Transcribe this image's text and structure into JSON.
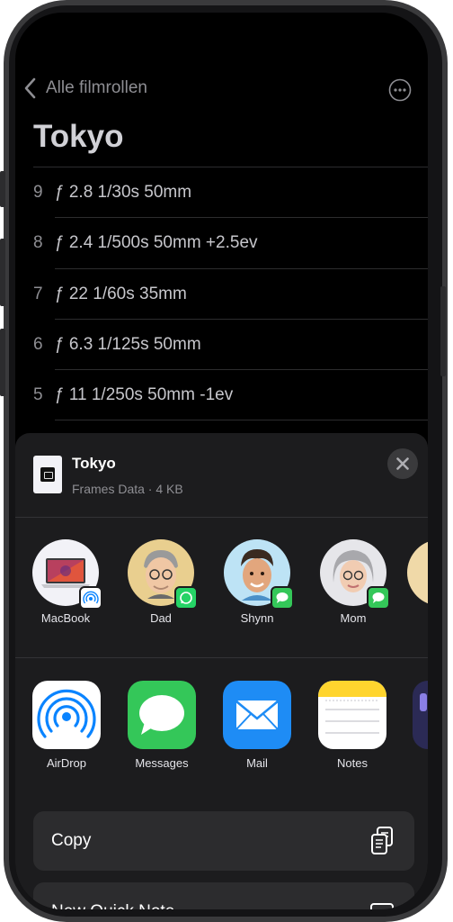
{
  "nav": {
    "back_label": "Alle filmrollen"
  },
  "roll": {
    "title": "Tokyo",
    "frames": [
      {
        "num": "9",
        "settings": "ƒ 2.8  1/30s  50mm"
      },
      {
        "num": "8",
        "settings": "ƒ 2.4  1/500s  50mm  +2.5ev"
      },
      {
        "num": "7",
        "settings": "ƒ 22  1/60s  35mm"
      },
      {
        "num": "6",
        "settings": "ƒ 6.3  1/125s  50mm"
      },
      {
        "num": "5",
        "settings": "ƒ 11  1/250s  50mm  -1ev"
      }
    ]
  },
  "share": {
    "file_name": "Tokyo",
    "file_meta": "Frames Data · 4 KB",
    "people": [
      {
        "name": "MacBook",
        "badge": "airdrop"
      },
      {
        "name": "Dad",
        "badge": "whatsapp"
      },
      {
        "name": "Shynn",
        "badge": "messages"
      },
      {
        "name": "Mom",
        "badge": "messages"
      }
    ],
    "apps": [
      {
        "name": "AirDrop"
      },
      {
        "name": "Messages"
      },
      {
        "name": "Mail"
      },
      {
        "name": "Notes"
      }
    ],
    "actions": [
      {
        "label": "Copy",
        "icon": "copy-icon"
      },
      {
        "label": "New Quick Note",
        "icon": "quick-note-icon"
      }
    ]
  },
  "colors": {
    "whatsapp": "#25d366",
    "messages": "#34c759",
    "mail": "#1e8cf5",
    "notes_yellow": "#ffd52e"
  }
}
